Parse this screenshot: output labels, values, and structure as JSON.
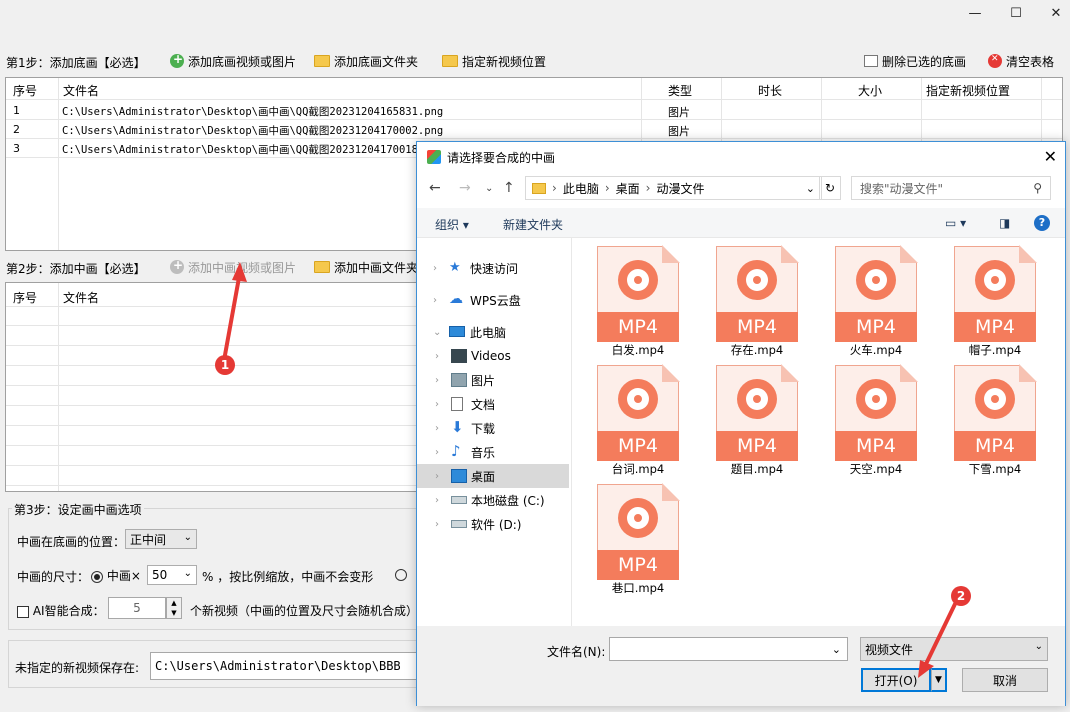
{
  "window": {
    "controls": {
      "minimize": "—",
      "maximize": "☐",
      "close": "✕"
    }
  },
  "step1": {
    "label": "第1步：添加底画【必选】",
    "buttons": {
      "add_media": "添加底画视频或图片",
      "add_folder": "添加底画文件夹",
      "set_location": "指定新视频位置",
      "delete_selected": "删除已选的底画",
      "clear_table": "清空表格"
    },
    "columns": [
      "序号",
      "文件名",
      "类型",
      "时长",
      "大小",
      "指定新视频位置"
    ],
    "rows": [
      {
        "index": "1",
        "filename": "C:\\Users\\Administrator\\Desktop\\画中画\\QQ截图20231204165831.png",
        "type": "图片"
      },
      {
        "index": "2",
        "filename": "C:\\Users\\Administrator\\Desktop\\画中画\\QQ截图20231204170002.png",
        "type": "图片"
      },
      {
        "index": "3",
        "filename": "C:\\Users\\Administrator\\Desktop\\画中画\\QQ截图20231204170018.",
        "type": ""
      }
    ]
  },
  "step2": {
    "label": "第2步：添加中画【必选】",
    "buttons": {
      "add_media": "添加中画视频或图片",
      "add_folder": "添加中画文件夹"
    },
    "columns": [
      "序号",
      "文件名"
    ]
  },
  "step3": {
    "label": "第3步：设定画中画选项",
    "position_label": "中画在底画的位置：",
    "position_value": "正中间",
    "size_label": "中画的尺寸：",
    "size_option": "中画×",
    "size_value": "50",
    "size_suffix": "% ，按比例缩放，中画不会变形",
    "ai_label": "AI智能合成：",
    "ai_count": "5",
    "ai_suffix": "个新视频（中画的位置及尺寸会随机合成）",
    "save_label": "未指定的新视频保存在:",
    "save_path": "C:\\Users\\Administrator\\Desktop\\BBB"
  },
  "dialog": {
    "title": "请选择要合成的中画",
    "breadcrumb": [
      "此电脑",
      "桌面",
      "动漫文件"
    ],
    "search_placeholder": "搜索\"动漫文件\"",
    "organize": "组织 ▾",
    "new_folder": "新建文件夹",
    "nav": [
      {
        "label": "快速访问",
        "icon": "star-icon"
      },
      {
        "label": "WPS云盘",
        "icon": "cloud-icon"
      },
      {
        "label": "此电脑",
        "icon": "computer-icon"
      },
      {
        "label": "Videos",
        "icon": "video-folder-icon"
      },
      {
        "label": "图片",
        "icon": "pictures-folder-icon"
      },
      {
        "label": "文档",
        "icon": "documents-folder-icon"
      },
      {
        "label": "下载",
        "icon": "download-icon"
      },
      {
        "label": "音乐",
        "icon": "music-icon"
      },
      {
        "label": "桌面",
        "icon": "desktop-icon"
      },
      {
        "label": "本地磁盘 (C:)",
        "icon": "disk-icon"
      },
      {
        "label": "软件 (D:)",
        "icon": "disk-icon"
      }
    ],
    "files": [
      "白发.mp4",
      "存在.mp4",
      "火车.mp4",
      "帽子.mp4",
      "台词.mp4",
      "题目.mp4",
      "天空.mp4",
      "下雪.mp4",
      "巷口.mp4"
    ],
    "file_badge": "MP4",
    "filename_label": "文件名(N):",
    "filename_value": "",
    "filetype_value": "视频文件",
    "open_button": "打开(O)",
    "cancel_button": "取消"
  },
  "markers": [
    "1",
    "2"
  ],
  "colors": {
    "marker": "#e53935",
    "mp4_accent": "#f47c5c",
    "dialog_border": "#3d8fd6"
  }
}
